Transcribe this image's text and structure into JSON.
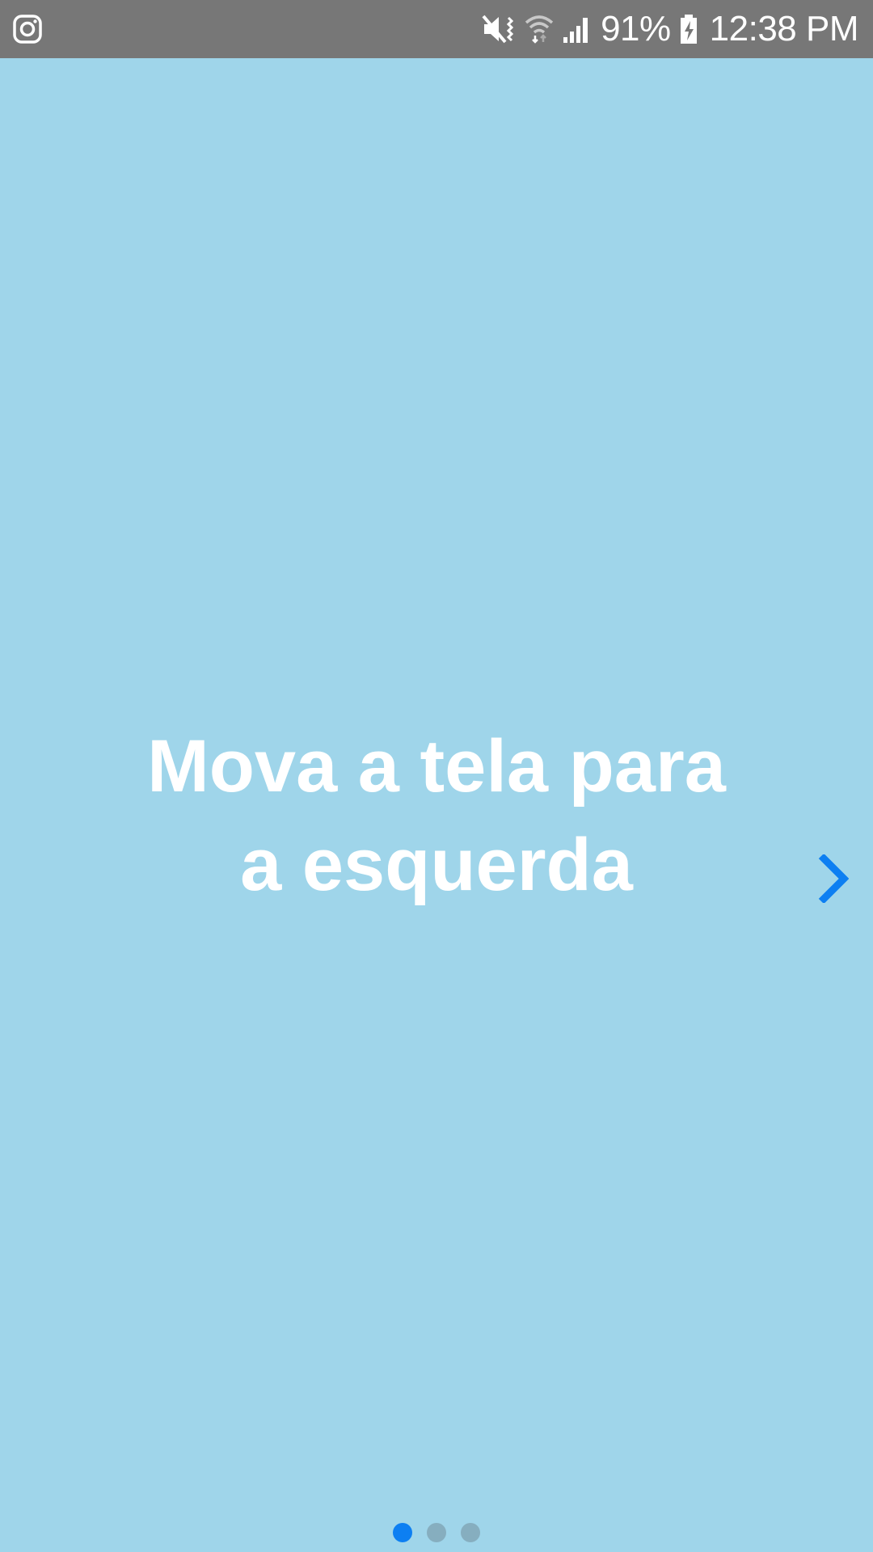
{
  "status_bar": {
    "battery_percent": "91%",
    "time": "12:38 PM",
    "icons": [
      "instagram-icon",
      "mute-vibrate-icon",
      "wifi-icon",
      "signal-icon",
      "battery-charging-icon"
    ]
  },
  "slide": {
    "title_line1": "Mova a tela para",
    "title_line2": "a esquerda",
    "next_icon": "chevron-right-icon",
    "page_count": 3,
    "active_page": 1
  },
  "colors": {
    "background": "#9fd5ea",
    "status_bar": "#777777",
    "accent": "#0d7ff2",
    "dot_inactive": "#86aebf",
    "title": "#ffffff"
  }
}
